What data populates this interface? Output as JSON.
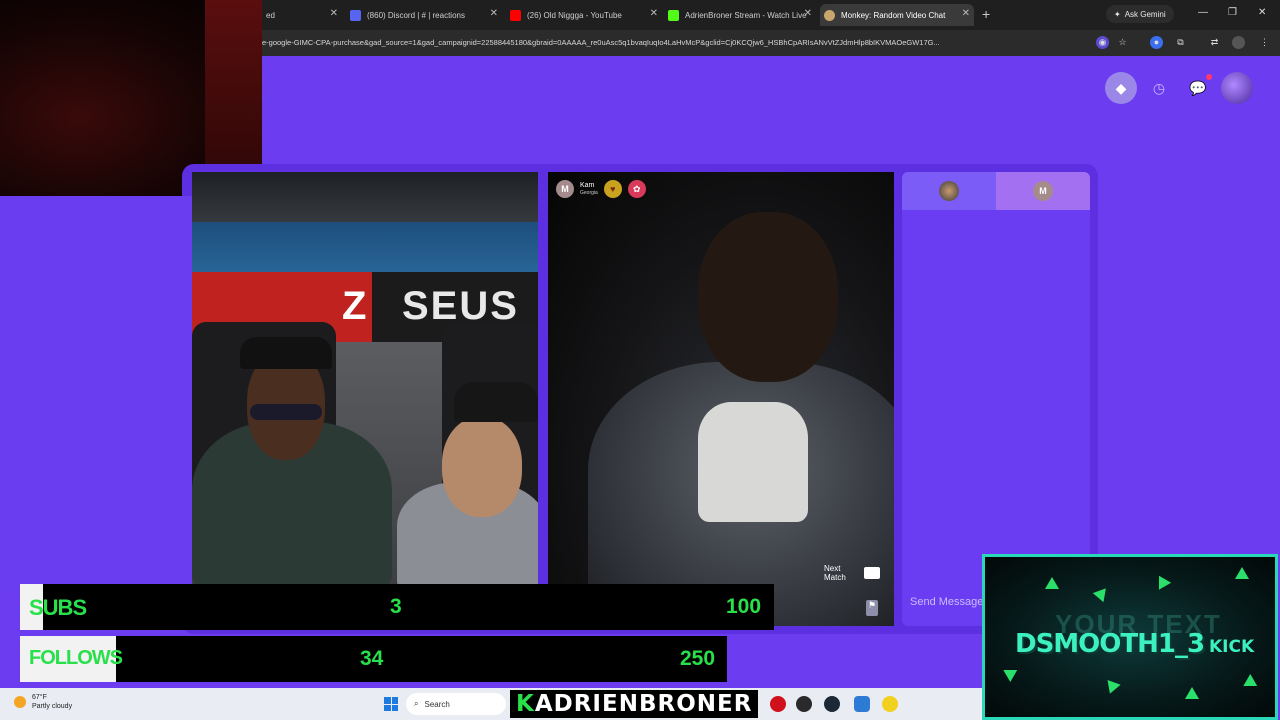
{
  "browser": {
    "tabs": [
      {
        "label": "ed",
        "favicon_color": "#444444",
        "active": false
      },
      {
        "label": "(860) Discord | # | reactions",
        "favicon_color": "#5865f2",
        "active": false
      },
      {
        "label": "(26) Old Niggga - YouTube",
        "favicon_color": "#ff0000",
        "active": false
      },
      {
        "label": "AdrienBroner Stream - Watch Live",
        "favicon_color": "#53fc18",
        "active": false
      },
      {
        "label": "Monkey: Random Video Chat",
        "favicon_color": "#c9a66b",
        "active": true
      }
    ],
    "new_tab_label": "+",
    "gemini_label": "Ask Gemini",
    "url": "e-google-GIMC-CPA-purchase&gad_source=1&gad_campaignid=22588445180&gbraid=0AAAAA_re0uAsc5q1bvaqIuqIo4LaHvMcP&gclid=Cj0KCQjw6_HSBhCpARIsANvVtZJdmHlp8bIKVMAOeGW17G..."
  },
  "site": {
    "header_icons": [
      "gem-icon",
      "clock-icon",
      "chat-bubble-icon",
      "profile-avatar"
    ]
  },
  "peer": {
    "avatar_initial": "M",
    "name": "Kam",
    "location": "Georgia"
  },
  "controls": {
    "next_match": "Next Match"
  },
  "chat": {
    "tab2_initial": "M",
    "input_placeholder": "Send Message"
  },
  "overlays": {
    "subs": {
      "label": "SUBS",
      "current": "3",
      "target": "100",
      "progress": 0.03
    },
    "follows": {
      "label": "FOLLOWS",
      "current": "34",
      "target": "250",
      "progress": 0.136
    },
    "streamer_name": "DSMOOTH1_3",
    "platform": "KICK",
    "ghost_text": "YOUR TEXT",
    "broadcaster_plate": {
      "first": "K",
      "rest": "ADRIENBRONER"
    }
  },
  "taskbar": {
    "temperature": "67°F",
    "condition": "Partly cloudy",
    "search_placeholder": "Search"
  }
}
